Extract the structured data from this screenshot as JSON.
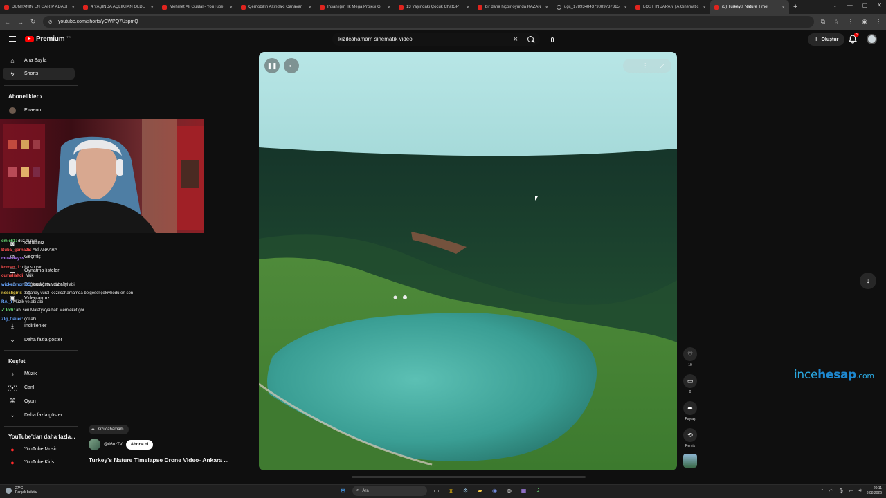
{
  "browser": {
    "tabs": [
      {
        "title": "DÜNYANIN EN GARİP ADASI",
        "favicon": "youtube-icon"
      },
      {
        "title": "4 YAŞINDA AÇLIKTAN ÖLDÜ",
        "favicon": "youtube-icon"
      },
      {
        "title": "Mehmet Ali Güldal - YouTube",
        "favicon": "youtube-icon"
      },
      {
        "title": "Çernobil'in Altındaki Canavar",
        "favicon": "youtube-icon"
      },
      {
        "title": "İnsanlığın İlk Mega Projesi G",
        "favicon": "youtube-icon"
      },
      {
        "title": "13 Yaşındaki Çocuk ChatGPT",
        "favicon": "youtube-icon"
      },
      {
        "title": "bir daha hiçbir oyunda KAZAN",
        "favicon": "youtube-icon"
      },
      {
        "title": "ugc_17893484379089737315",
        "favicon": "globe-icon"
      },
      {
        "title": "LOST IN JAPAN | A Cinematic",
        "favicon": "youtube-icon"
      },
      {
        "title": "(3) Turkey's Nature Timel",
        "favicon": "youtube-icon",
        "active": true
      }
    ],
    "url": "youtube.com/shorts/yCWPQ7UspmQ"
  },
  "header": {
    "logo_text": "Premium",
    "logo_region": "TR",
    "search_query": "kızılcahamam sinematik video",
    "create_label": "Oluştur",
    "notification_count": "3"
  },
  "sidebar": {
    "home": "Ana Sayfa",
    "shorts": "Shorts",
    "subscriptions_header": "Abonelikler",
    "subscription_channel": "Elraenn",
    "you_items": [
      "Kanalınız",
      "Geçmiş",
      "Oynatma listeleri",
      "Videolarınız",
      "Sonra izle",
      "Beğendiğim videolar",
      "İndirilenler"
    ],
    "show_more": "Daha fazla göster",
    "explore_header": "Keşfet",
    "explore_items": [
      "Müzik",
      "Canlı",
      "Oyun"
    ],
    "explore_show_more": "Daha fazla göster",
    "more_header": "YouTube'dan daha fazla...",
    "more_items": [
      "YouTube Music",
      "YouTube Kids"
    ]
  },
  "chat": [
    {
      "user": "emlc61:",
      "text": "düz dünya",
      "color": "#6ee07a"
    },
    {
      "user": "Buba_gorna25:",
      "text": "ABİ ANKARA",
      "color": "#ff5252"
    },
    {
      "user": "mustafayss",
      "text": "",
      "color": "#b67bff"
    },
    {
      "user": "korcan_1:",
      "text": "oha su var",
      "color": "#ff5252"
    },
    {
      "user": "cumalialtdi:",
      "text": "Mük",
      "color": "#ff5252"
    },
    {
      "user": "wickedmorti35:",
      "text": "kazakistan daha iyi abi",
      "color": "#6aa8ff"
    },
    {
      "user": "nessligirli:",
      "text": "doğanay vural kkızılcahamamda belgesel çekiyhodu en son",
      "color": "#e3c84a"
    },
    {
      "user": "RAI_i",
      "text": "Müzik ye abi abi",
      "color": "#6aa8ff"
    },
    {
      "user": "✔ lodi:",
      "text": "abi sen Malatya'ya bak Memleket gör",
      "color": "#6ee07a"
    },
    {
      "user": "Zlg_Dauer:",
      "text": "çöl abi",
      "color": "#6aa8ff"
    }
  ],
  "short": {
    "location": "Kızılcahamam",
    "channel": "@06uzTV",
    "subscribe_label": "Abone ol",
    "title": "Turkey's Nature Timelapse Drone Video- Ankara ...",
    "likes": "10",
    "comments": "0",
    "share_label": "Paylaş",
    "remix_label": "Remix"
  },
  "watermark": {
    "part1": "ince",
    "part2": "hesap",
    "part3": ".com",
    "color": "#2aa8e0"
  },
  "taskbar": {
    "weather_temp": "27°C",
    "weather_desc": "Parçalı bulutlu",
    "search_label": "Ara",
    "time": "20:11",
    "date": "3.08.2026"
  }
}
